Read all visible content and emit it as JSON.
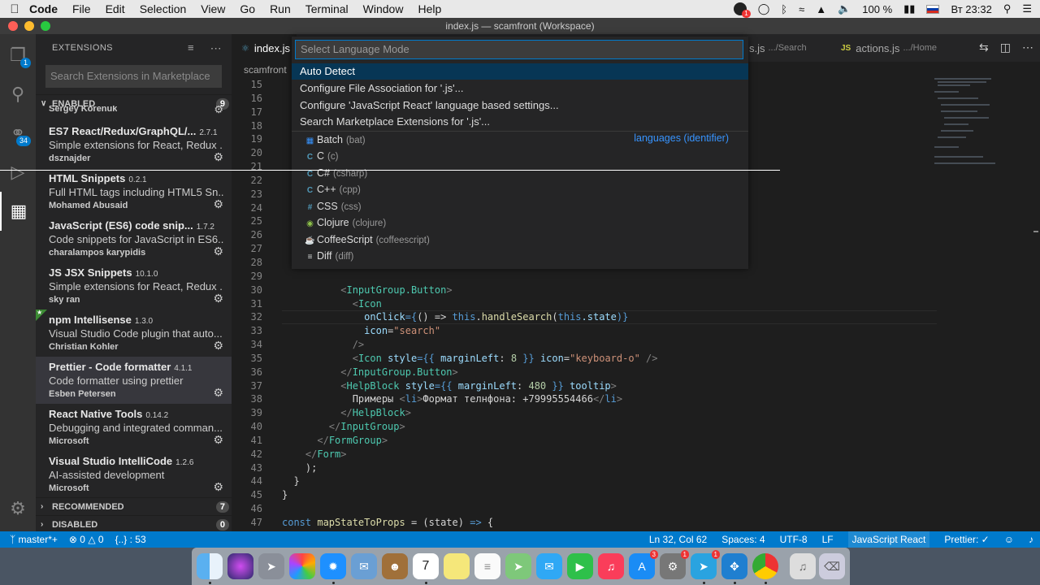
{
  "menubar": {
    "app_name": "Code",
    "items": [
      "File",
      "Edit",
      "Selection",
      "View",
      "Go",
      "Run",
      "Terminal",
      "Window",
      "Help"
    ],
    "notification_count": "1",
    "battery": "100 %",
    "clock": "Вт 23:32"
  },
  "window": {
    "title": "index.js — scamfront (Workspace)"
  },
  "activity": {
    "explorer_badge": "1",
    "scm_badge": "34"
  },
  "sidebar": {
    "title": "EXTENSIONS",
    "search_placeholder": "Search Extensions in Marketplace",
    "enabled_label": "ENABLED",
    "enabled_count": "9",
    "partial_author": "Sergey Korenuk",
    "extensions": [
      {
        "name": "ES7 React/Redux/GraphQL/...",
        "version": "2.7.1",
        "description": "Simple extensions for React, Redux ...",
        "author": "dsznajder"
      },
      {
        "name": "HTML Snippets",
        "version": "0.2.1",
        "description": "Full HTML tags including HTML5 Sn...",
        "author": "Mohamed Abusaid"
      },
      {
        "name": "JavaScript (ES6) code snip...",
        "version": "1.7.2",
        "description": "Code snippets for JavaScript in ES6...",
        "author": "charalampos karypidis"
      },
      {
        "name": "JS JSX Snippets",
        "version": "10.1.0",
        "description": "Simple extensions for React, Redux ...",
        "author": "sky ran"
      },
      {
        "name": "npm Intellisense",
        "version": "1.3.0",
        "description": "Visual Studio Code plugin that auto...",
        "author": "Christian Kohler"
      },
      {
        "name": "Prettier - Code formatter",
        "version": "4.1.1",
        "description": "Code formatter using prettier",
        "author": "Esben Petersen"
      },
      {
        "name": "React Native Tools",
        "version": "0.14.2",
        "description": "Debugging and integrated comman...",
        "author": "Microsoft"
      },
      {
        "name": "Visual Studio IntelliCode",
        "version": "1.2.6",
        "description": "AI-assisted development",
        "author": "Microsoft"
      }
    ],
    "recommended_label": "RECOMMENDED",
    "recommended_count": "7",
    "disabled_label": "DISABLED",
    "disabled_count": "0"
  },
  "tabs": {
    "active": "index.js",
    "tab2_name": "s.js",
    "tab2_path": ".../Search",
    "tab3_name": "actions.js",
    "tab3_path": ".../Home",
    "js_icon": "JS"
  },
  "breadcrumb": "scamfront",
  "quickpick": {
    "placeholder": "Select Language Mode",
    "actions": [
      "Auto Detect",
      "Configure File Association for '.js'...",
      "Configure 'JavaScript React' language based settings...",
      "Search Marketplace Extensions for '.js'..."
    ],
    "group_label": "languages (identifier)",
    "languages": [
      {
        "name": "Batch",
        "id": "(bat)",
        "icon": "windows-icon",
        "color": "#3794ff"
      },
      {
        "name": "C",
        "id": "(c)",
        "icon": "c-icon",
        "color": "#519aba"
      },
      {
        "name": "C#",
        "id": "(csharp)",
        "icon": "csharp-icon",
        "color": "#519aba"
      },
      {
        "name": "C++",
        "id": "(cpp)",
        "icon": "cpp-icon",
        "color": "#519aba"
      },
      {
        "name": "CSS",
        "id": "(css)",
        "icon": "css-icon",
        "color": "#519aba"
      },
      {
        "name": "Clojure",
        "id": "(clojure)",
        "icon": "clojure-icon",
        "color": "#8dc149"
      },
      {
        "name": "CoffeeScript",
        "id": "(coffeescript)",
        "icon": "coffee-icon",
        "color": "#cbcb41"
      },
      {
        "name": "Diff",
        "id": "(diff)",
        "icon": "diff-icon",
        "color": "#d4d7d6"
      }
    ]
  },
  "line_numbers": [
    "15",
    "16",
    "17",
    "18",
    "19",
    "20",
    "21",
    "22",
    "23",
    "24",
    "25",
    "26",
    "27",
    "28",
    "29",
    "30",
    "31",
    "32",
    "33",
    "34",
    "35",
    "36",
    "37",
    "38",
    "39",
    "40",
    "41",
    "42",
    "43",
    "44",
    "45",
    "46",
    "47"
  ],
  "code": {
    "l30a": "<",
    "l30b": "InputGroup.Button",
    "l30c": ">",
    "l31a": "<",
    "l31b": "Icon",
    "l32a": "onClick",
    "l32b": "={",
    "l32c": "() => ",
    "l32d": "this",
    "l32e": ".",
    "l32f": "handleSearch",
    "l32g": "(",
    "l32h": "this",
    "l32i": ".state",
    "l32j": ")}",
    "l33a": "icon",
    "l33b": "=",
    "l33c": "\"search\"",
    "l34a": "/>",
    "l35a": "<",
    "l35b": "Icon",
    "l35c": " style",
    "l35d": "={{ ",
    "l35e": "marginLeft",
    "l35f": ": ",
    "l35g": "8",
    "l35h": " }} ",
    "l35i": "icon",
    "l35j": "=",
    "l35k": "\"keyboard-o\"",
    "l35l": " />",
    "l36a": "</",
    "l36b": "InputGroup.Button",
    "l36c": ">",
    "l37a": "<",
    "l37b": "HelpBlock",
    "l37c": " style",
    "l37d": "={{ ",
    "l37e": "marginLeft",
    "l37f": ": ",
    "l37g": "480",
    "l37h": " }} ",
    "l37i": "tooltip",
    "l37j": ">",
    "l38a": "Примеры ",
    "l38b": "<",
    "l38c": "li",
    "l38d": ">",
    "l38e": "Формат телнфона: +79995554466",
    "l38f": "</",
    "l38g": "li",
    "l38h": ">",
    "l39a": "</",
    "l39b": "HelpBlock",
    "l39c": ">",
    "l40a": "</",
    "l40b": "InputGroup",
    "l40c": ">",
    "l41a": "</",
    "l41b": "FormGroup",
    "l41c": ">",
    "l42a": "</",
    "l42b": "Form",
    "l42c": ">",
    "l43a": ");",
    "l44a": "}",
    "l45a": "}",
    "l47a": "const ",
    "l47b": "mapStateToProps",
    "l47c": " = (state) ",
    "l47d": "=>",
    "l47e": " {"
  },
  "status": {
    "branch": "master*+",
    "problems_errors": "0",
    "problems_warnings": "0",
    "outline": "{..} : 53",
    "position": "Ln 32, Col 62",
    "spaces": "Spaces: 4",
    "encoding": "UTF-8",
    "eol": "LF",
    "language": "JavaScript React",
    "formatter": "Prettier: ✓"
  },
  "dock": {
    "calendar_day": "7",
    "appstore_badge": "3",
    "prefs_badge": "1",
    "telegram_badge": "1"
  }
}
